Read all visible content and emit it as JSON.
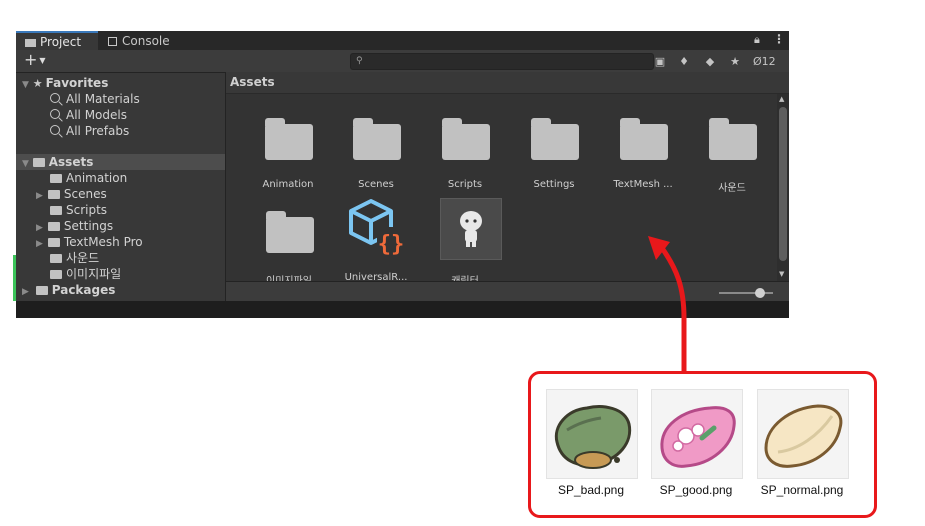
{
  "tabs": [
    {
      "label": "Project",
      "icon": "folder-icon",
      "active": true
    },
    {
      "label": "Console",
      "icon": "console-icon",
      "active": false
    }
  ],
  "toolbar": {
    "add_label": "+",
    "hidden_count": "12",
    "search_placeholder": ""
  },
  "tree": {
    "favorites": {
      "label": "Favorites",
      "items": [
        "All Materials",
        "All Models",
        "All Prefabs"
      ]
    },
    "assets": {
      "label": "Assets",
      "children": [
        "Animation",
        "Scenes",
        "Scripts",
        "Settings",
        "TextMesh Pro",
        "사운드",
        "이미지파일"
      ]
    },
    "packages": {
      "label": "Packages"
    }
  },
  "grid": {
    "breadcrumb": "Assets",
    "items": [
      {
        "label": "Animation",
        "icon": "folder-icon"
      },
      {
        "label": "Scenes",
        "icon": "folder-icon"
      },
      {
        "label": "Scripts",
        "icon": "folder-icon"
      },
      {
        "label": "Settings",
        "icon": "folder-icon"
      },
      {
        "label": "TextMesh ...",
        "icon": "folder-icon"
      },
      {
        "label": "사운드",
        "icon": "folder-icon"
      },
      {
        "label": "이미지파일",
        "icon": "folder-icon"
      },
      {
        "label": "UniversalR...",
        "icon": "script-asset-icon"
      },
      {
        "label": "캐릭터",
        "icon": "character-sprite-icon"
      }
    ]
  },
  "sprites": [
    {
      "label": "SP_bad.png",
      "color": "#7a9a6a"
    },
    {
      "label": "SP_good.png",
      "color": "#f09ac6"
    },
    {
      "label": "SP_normal.png",
      "color": "#f6e6c4"
    }
  ],
  "colors": {
    "accent_red": "#e8181b",
    "tab_accent": "#3a79bb"
  }
}
